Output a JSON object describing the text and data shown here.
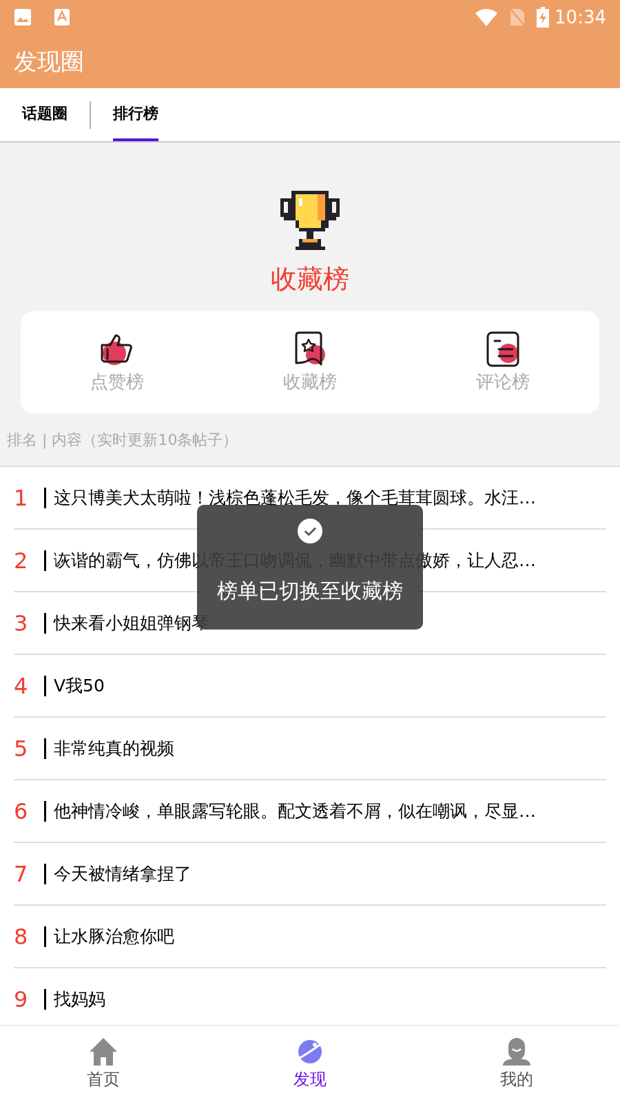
{
  "status_bar": {
    "time": "10:34"
  },
  "app_bar": {
    "title": "发现圈"
  },
  "tabs": [
    {
      "label": "话题圈",
      "selected": false
    },
    {
      "label": "排行榜",
      "selected": true
    }
  ],
  "ranking": {
    "title": "收藏榜",
    "categories": [
      {
        "label": "点赞榜",
        "kind": "like"
      },
      {
        "label": "收藏榜",
        "kind": "favorite"
      },
      {
        "label": "评论榜",
        "kind": "comment"
      }
    ],
    "caption": "排名 | 内容（实时更新10条帖子）"
  },
  "posts": [
    {
      "rank": "1",
      "text": "这只博美犬太萌啦！浅棕色蓬松毛发，像个毛茸茸圆球。水汪…"
    },
    {
      "rank": "2",
      "text": "诙谐的霸气，仿佛以帝王口吻调侃，幽默中带点傲娇，让人忍…"
    },
    {
      "rank": "3",
      "text": "快来看小姐姐弹钢琴"
    },
    {
      "rank": "4",
      "text": "V我50"
    },
    {
      "rank": "5",
      "text": "非常纯真的视频"
    },
    {
      "rank": "6",
      "text": "他神情冷峻，单眼露写轮眼。配文透着不屑，似在嘲讽，尽显…"
    },
    {
      "rank": "7",
      "text": "今天被情绪拿捏了"
    },
    {
      "rank": "8",
      "text": "让水豚治愈你吧"
    },
    {
      "rank": "9",
      "text": "找妈妈"
    }
  ],
  "toast": {
    "message": "榜单已切换至收藏榜"
  },
  "bottom_nav": [
    {
      "label": "首页",
      "kind": "home",
      "selected": false
    },
    {
      "label": "发现",
      "kind": "discover",
      "selected": true
    },
    {
      "label": "我的",
      "kind": "profile",
      "selected": false
    }
  ]
}
